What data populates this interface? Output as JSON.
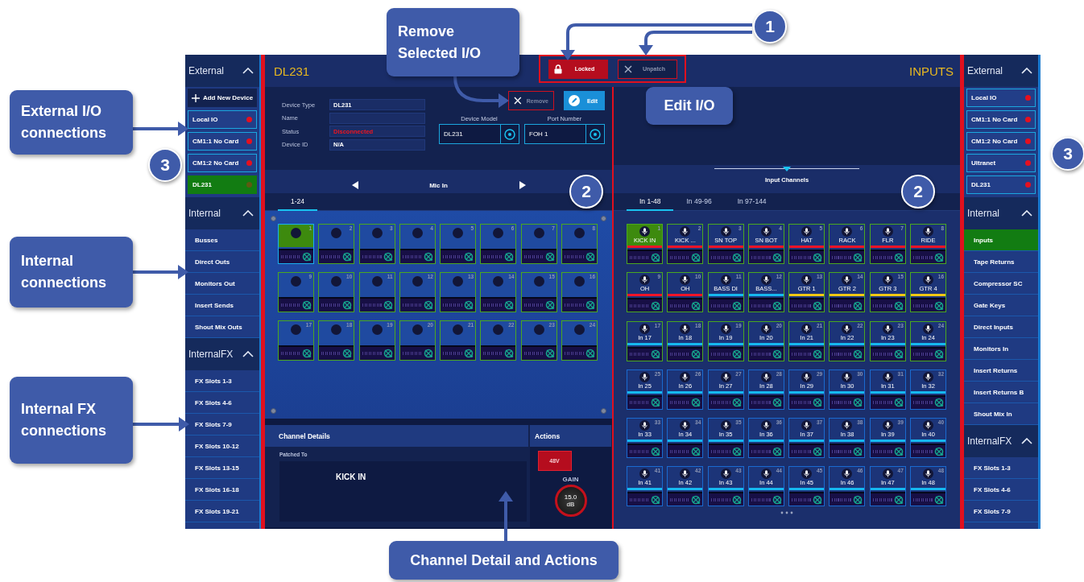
{
  "callouts": [
    "External I/O connections",
    "Internal connections",
    "Internal FX connections",
    "Remove Selected I/O",
    "Edit I/O",
    "Channel Detail and Actions"
  ],
  "number_badges": [
    "1",
    "3",
    "3",
    "2",
    "2"
  ],
  "left_sidebar": {
    "sections": [
      {
        "title": "External",
        "expanded": true,
        "items": [
          {
            "kind": "add",
            "label": "Add New Device",
            "selected": false
          },
          {
            "kind": "device",
            "label": "Local IO",
            "selected": false
          },
          {
            "kind": "device",
            "label": "CM1:1 No Card",
            "selected": false
          },
          {
            "kind": "device",
            "label": "CM1:2 No Card",
            "selected": false
          },
          {
            "kind": "device",
            "label": "DL231",
            "selected": true
          }
        ]
      },
      {
        "title": "Internal",
        "expanded": true,
        "items": [
          {
            "kind": "link",
            "label": "Busses",
            "selected": false
          },
          {
            "kind": "link",
            "label": "Direct Outs",
            "selected": false
          },
          {
            "kind": "link",
            "label": "Monitors Out",
            "selected": false
          },
          {
            "kind": "link",
            "label": "Insert Sends",
            "selected": false
          },
          {
            "kind": "link",
            "label": "Shout Mix Outs",
            "selected": false
          }
        ]
      },
      {
        "title": "InternalFX",
        "expanded": true,
        "items": [
          {
            "kind": "link",
            "label": "FX Slots 1-3",
            "selected": false
          },
          {
            "kind": "link",
            "label": "FX Slots 4-6",
            "selected": false
          },
          {
            "kind": "link",
            "label": "FX Slots 7-9",
            "selected": false
          },
          {
            "kind": "link",
            "label": "FX Slots 10-12",
            "selected": false
          },
          {
            "kind": "link",
            "label": "FX Slots 13-15",
            "selected": false
          },
          {
            "kind": "link",
            "label": "FX Slots 16-18",
            "selected": false
          },
          {
            "kind": "link",
            "label": "FX Slots 19-21",
            "selected": false
          }
        ]
      }
    ]
  },
  "header": {
    "device_title": "DL231",
    "view_title": "INPUTS",
    "lock_button": {
      "label": "Locked",
      "locked": true
    },
    "unpatch_button": {
      "label": "Unpatch",
      "disabled": true
    }
  },
  "device_panel": {
    "fields": [
      {
        "label": "Device Type",
        "value": "DL231",
        "kind": "plain"
      },
      {
        "label": "Name",
        "kind": "plain"
      },
      {
        "label": "Status",
        "value": "Disconnected",
        "kind": "alert"
      },
      {
        "label": "Device ID",
        "value": "N/A",
        "kind": "plain"
      }
    ],
    "remove_button": {
      "label": "Remove",
      "disabled": true
    },
    "edit_button": {
      "label": "Edit"
    },
    "device_model": {
      "label": "Device Model",
      "value": "DL231"
    },
    "port_number": {
      "label": "Port Number",
      "value": "FOH 1"
    },
    "port_type": "Mic In",
    "tabs": [
      {
        "label": "1-24",
        "selected": true
      }
    ],
    "ports": [
      {
        "number": "1",
        "selected": true
      },
      {
        "number": "2",
        "selected": false
      },
      {
        "number": "3",
        "selected": false
      },
      {
        "number": "4",
        "selected": false
      },
      {
        "number": "5",
        "selected": false
      },
      {
        "number": "6",
        "selected": false
      },
      {
        "number": "7",
        "selected": false
      },
      {
        "number": "8",
        "selected": false
      },
      {
        "number": "9",
        "selected": false
      },
      {
        "number": "10",
        "selected": false
      },
      {
        "number": "11",
        "selected": false
      },
      {
        "number": "12",
        "selected": false
      },
      {
        "number": "13",
        "selected": false
      },
      {
        "number": "14",
        "selected": false
      },
      {
        "number": "15",
        "selected": false
      },
      {
        "number": "16",
        "selected": false
      },
      {
        "number": "17",
        "selected": false
      },
      {
        "number": "18",
        "selected": false
      },
      {
        "number": "19",
        "selected": false
      },
      {
        "number": "20",
        "selected": false
      },
      {
        "number": "21",
        "selected": false
      },
      {
        "number": "22",
        "selected": false
      },
      {
        "number": "23",
        "selected": false
      },
      {
        "number": "24",
        "selected": false
      }
    ],
    "channel_details": {
      "title": "Channel Details",
      "patched_to_label": "Patched To",
      "patched_to": "KICK IN"
    },
    "actions": {
      "title": "Actions",
      "phantom_button": {
        "label": "48V",
        "on": true
      },
      "gain_label": "GAIN",
      "gain_value": "15.0 dB"
    }
  },
  "input_panel": {
    "title": "Input Channels",
    "range_slider": {
      "level": 0.5
    },
    "tabs": [
      {
        "label": "In 1-48",
        "selected": true
      },
      {
        "label": "In 49-96",
        "selected": false
      },
      {
        "label": "In 97-144",
        "selected": false
      }
    ],
    "channels": [
      {
        "number": "1",
        "name": "KICK IN",
        "color": "#f01428",
        "patched": true,
        "selected": true
      },
      {
        "number": "2",
        "name": "KICK ...",
        "color": "#f01428",
        "patched": true,
        "selected": false
      },
      {
        "number": "3",
        "name": "SN TOP",
        "color": "#f01428",
        "patched": true,
        "selected": false
      },
      {
        "number": "4",
        "name": "SN BOT",
        "color": "#f01428",
        "patched": true,
        "selected": false
      },
      {
        "number": "5",
        "name": "HAT",
        "color": "#f01428",
        "patched": true,
        "selected": false
      },
      {
        "number": "6",
        "name": "RACK",
        "color": "#f01428",
        "patched": true,
        "selected": false
      },
      {
        "number": "7",
        "name": "FLR",
        "color": "#f01428",
        "patched": true,
        "selected": false
      },
      {
        "number": "8",
        "name": "RIDE",
        "color": "#f01428",
        "patched": true,
        "selected": false
      },
      {
        "number": "9",
        "name": "OH",
        "color": "#f01428",
        "patched": true,
        "selected": false
      },
      {
        "number": "10",
        "name": "OH",
        "color": "#f01428",
        "patched": true,
        "selected": false
      },
      {
        "number": "11",
        "name": "BASS DI",
        "color": "#16b8f0",
        "patched": true,
        "selected": false
      },
      {
        "number": "12",
        "name": "BASS...",
        "color": "#16b8f0",
        "patched": true,
        "selected": false
      },
      {
        "number": "13",
        "name": "GTR 1",
        "color": "#f0c814",
        "patched": true,
        "selected": false
      },
      {
        "number": "14",
        "name": "GTR 2",
        "color": "#f0c814",
        "patched": true,
        "selected": false
      },
      {
        "number": "15",
        "name": "GTR 3",
        "color": "#f0c814",
        "patched": true,
        "selected": false
      },
      {
        "number": "16",
        "name": "GTR 4",
        "color": "#f0c814",
        "patched": true,
        "selected": false
      },
      {
        "number": "17",
        "name": "In 17",
        "color": "#16b8f0",
        "patched": true,
        "selected": false
      },
      {
        "number": "18",
        "name": "In 18",
        "color": "#16b8f0",
        "patched": true,
        "selected": false
      },
      {
        "number": "19",
        "name": "In 19",
        "color": "#16b8f0",
        "patched": true,
        "selected": false
      },
      {
        "number": "20",
        "name": "In 20",
        "color": "#16b8f0",
        "patched": true,
        "selected": false
      },
      {
        "number": "21",
        "name": "In 21",
        "color": "#16b8f0",
        "patched": true,
        "selected": false
      },
      {
        "number": "22",
        "name": "In 22",
        "color": "#16b8f0",
        "patched": true,
        "selected": false
      },
      {
        "number": "23",
        "name": "In 23",
        "color": "#16b8f0",
        "patched": true,
        "selected": false
      },
      {
        "number": "24",
        "name": "In 24",
        "color": "#16b8f0",
        "patched": true,
        "selected": false
      },
      {
        "number": "25",
        "name": "In 25",
        "color": "#16b8f0",
        "patched": false,
        "selected": false
      },
      {
        "number": "26",
        "name": "In 26",
        "color": "#16b8f0",
        "patched": false,
        "selected": false
      },
      {
        "number": "27",
        "name": "In 27",
        "color": "#16b8f0",
        "patched": false,
        "selected": false
      },
      {
        "number": "28",
        "name": "In 28",
        "color": "#16b8f0",
        "patched": false,
        "selected": false
      },
      {
        "number": "29",
        "name": "In 29",
        "color": "#16b8f0",
        "patched": false,
        "selected": false
      },
      {
        "number": "30",
        "name": "In 30",
        "color": "#16b8f0",
        "patched": false,
        "selected": false
      },
      {
        "number": "31",
        "name": "In 31",
        "color": "#16b8f0",
        "patched": false,
        "selected": false
      },
      {
        "number": "32",
        "name": "In 32",
        "color": "#16b8f0",
        "patched": false,
        "selected": false
      },
      {
        "number": "33",
        "name": "In 33",
        "color": "#16b8f0",
        "patched": false,
        "selected": false
      },
      {
        "number": "34",
        "name": "In 34",
        "color": "#16b8f0",
        "patched": false,
        "selected": false
      },
      {
        "number": "35",
        "name": "In 35",
        "color": "#16b8f0",
        "patched": false,
        "selected": false
      },
      {
        "number": "36",
        "name": "In 36",
        "color": "#16b8f0",
        "patched": false,
        "selected": false
      },
      {
        "number": "37",
        "name": "In 37",
        "color": "#16b8f0",
        "patched": false,
        "selected": false
      },
      {
        "number": "38",
        "name": "In 38",
        "color": "#16b8f0",
        "patched": false,
        "selected": false
      },
      {
        "number": "39",
        "name": "In 39",
        "color": "#16b8f0",
        "patched": false,
        "selected": false
      },
      {
        "number": "40",
        "name": "In 40",
        "color": "#16b8f0",
        "patched": false,
        "selected": false
      },
      {
        "number": "41",
        "name": "In 41",
        "color": "#16b8f0",
        "patched": false,
        "selected": false
      },
      {
        "number": "42",
        "name": "In 42",
        "color": "#16b8f0",
        "patched": false,
        "selected": false
      },
      {
        "number": "43",
        "name": "In 43",
        "color": "#16b8f0",
        "patched": false,
        "selected": false
      },
      {
        "number": "44",
        "name": "In 44",
        "color": "#16b8f0",
        "patched": false,
        "selected": false
      },
      {
        "number": "45",
        "name": "In 45",
        "color": "#16b8f0",
        "patched": false,
        "selected": false
      },
      {
        "number": "46",
        "name": "In 46",
        "color": "#16b8f0",
        "patched": false,
        "selected": false
      },
      {
        "number": "47",
        "name": "In 47",
        "color": "#16b8f0",
        "patched": false,
        "selected": false
      },
      {
        "number": "48",
        "name": "In 48",
        "color": "#16b8f0",
        "patched": false,
        "selected": false
      }
    ]
  },
  "right_sidebar": {
    "sections": [
      {
        "title": "External",
        "expanded": true,
        "items": [
          {
            "kind": "device",
            "label": "Local IO",
            "selected": false
          },
          {
            "kind": "device",
            "label": "CM1:1 No Card",
            "selected": false
          },
          {
            "kind": "device",
            "label": "CM1:2 No Card",
            "selected": false
          },
          {
            "kind": "device",
            "label": "Ultranet",
            "selected": false
          },
          {
            "kind": "device",
            "label": "DL231",
            "selected": false
          }
        ]
      },
      {
        "title": "Internal",
        "expanded": true,
        "items": [
          {
            "kind": "link",
            "label": "Inputs",
            "selected": true
          },
          {
            "kind": "link",
            "label": "Tape Returns",
            "selected": false
          },
          {
            "kind": "link",
            "label": "Compressor SC",
            "selected": false
          },
          {
            "kind": "link",
            "label": "Gate Keys",
            "selected": false
          },
          {
            "kind": "link",
            "label": "Direct Inputs",
            "selected": false
          },
          {
            "kind": "link",
            "label": "Monitors In",
            "selected": false
          },
          {
            "kind": "link",
            "label": "Insert Returns",
            "selected": false
          },
          {
            "kind": "link",
            "label": "Insert Returns B",
            "selected": false
          },
          {
            "kind": "link",
            "label": "Shout Mix In",
            "selected": false
          }
        ]
      },
      {
        "title": "InternalFX",
        "expanded": true,
        "items": [
          {
            "kind": "link",
            "label": "FX Slots 1-3",
            "selected": false
          },
          {
            "kind": "link",
            "label": "FX Slots 4-6",
            "selected": false
          },
          {
            "kind": "link",
            "label": "FX Slots 7-9",
            "selected": false
          }
        ]
      }
    ]
  }
}
